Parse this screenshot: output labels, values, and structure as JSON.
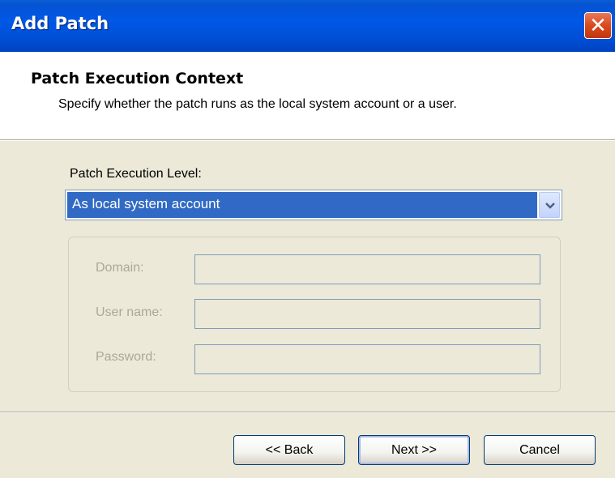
{
  "window": {
    "title": "Add Patch",
    "close_glyph": "✕"
  },
  "header": {
    "title": "Patch Execution Context",
    "subtitle": "Specify whether the patch runs as the local system account or a user."
  },
  "execution_level": {
    "label": "Patch Execution Level:",
    "selected": "As local system account"
  },
  "credentials": {
    "domain_label": "Domain:",
    "username_label": "User name:",
    "password_label": "Password:",
    "domain_value": "",
    "username_value": "",
    "password_value": ""
  },
  "buttons": {
    "back": "<< Back",
    "next": "Next >>",
    "cancel": "Cancel"
  },
  "colors": {
    "titlebar": "#0058e6",
    "selection": "#316ac5",
    "dialog_bg": "#ece9d8",
    "close": "#d84a1f"
  }
}
